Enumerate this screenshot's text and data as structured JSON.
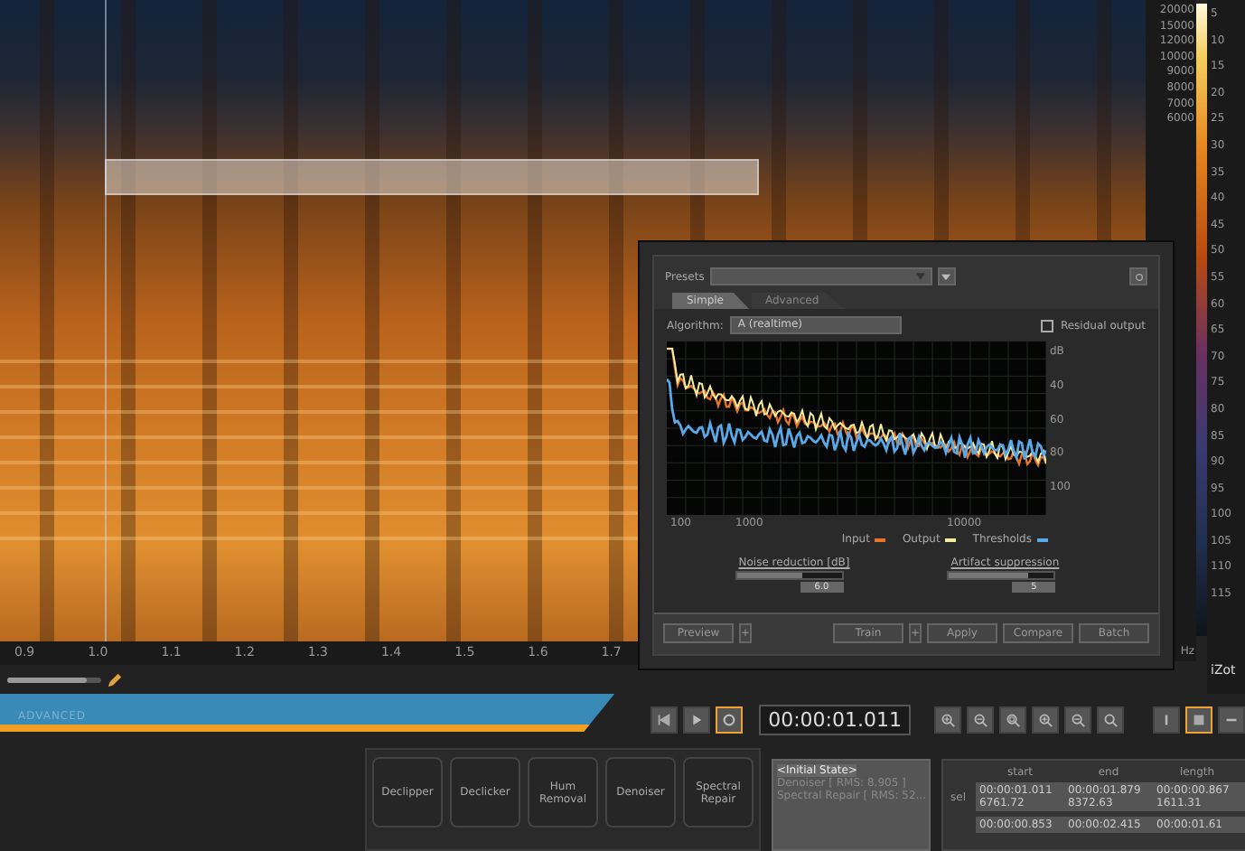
{
  "spectrogram": {
    "time_ticks": [
      "0.9",
      "1.0",
      "1.1",
      "1.2",
      "1.3",
      "1.4",
      "1.5",
      "1.6",
      "1.7"
    ],
    "freq_labels": [
      "20000",
      "15000",
      "12000",
      "10000",
      "9000",
      "8000",
      "7000",
      "6000"
    ],
    "unit": "Hz",
    "db_labels": [
      "5",
      "10",
      "15",
      "20",
      "25",
      "30",
      "35",
      "40",
      "45",
      "50",
      "55",
      "60",
      "65",
      "70",
      "75",
      "80",
      "85",
      "90",
      "95",
      "100",
      "105",
      "110",
      "115"
    ],
    "logo": "iZot",
    "zoom_slider": {
      "level": 0.85
    }
  },
  "dialog": {
    "presets_label": "Presets",
    "tabs": [
      {
        "label": "Simple",
        "selected": true
      },
      {
        "label": "Advanced",
        "selected": false
      }
    ],
    "algorithm_label": "Algorithm:",
    "algorithm_value": "A (realtime)",
    "residual": {
      "label": "Residual output",
      "checked": false
    },
    "plot": {
      "x_ticks": [
        "100",
        "1000",
        "10000"
      ],
      "y_labels": [
        "dB",
        "40",
        "60",
        "80",
        "100"
      ]
    },
    "legend": [
      {
        "label": "Input",
        "color": "#e8742a"
      },
      {
        "label": "Output",
        "color": "#f2eda0"
      },
      {
        "label": "Thresholds",
        "color": "#5aa8e8"
      }
    ],
    "sliders": [
      {
        "label": "Noise reduction [dB]",
        "value": "6.0",
        "level": 0.62
      },
      {
        "label": "Artifact suppression",
        "value": "5",
        "level": 0.75
      }
    ],
    "buttons": [
      {
        "label": "Preview",
        "kind": "wide"
      },
      {
        "label": "+",
        "kind": "small"
      },
      {
        "label": "Train",
        "kind": "wide"
      },
      {
        "label": "+",
        "kind": "small"
      },
      {
        "label": "Apply",
        "kind": "wide"
      },
      {
        "label": "Compare",
        "kind": "wide"
      },
      {
        "label": "Batch",
        "kind": "wide"
      }
    ]
  },
  "mode_label": "ADVANCED",
  "transport": [
    {
      "kind": "skip-start",
      "selected": false
    },
    {
      "kind": "play",
      "selected": false
    },
    {
      "kind": "loop",
      "selected": true
    }
  ],
  "time_display": "00:00:01.011",
  "zoom_tools": [
    {
      "kind": "zoom-in"
    },
    {
      "kind": "zoom-out"
    },
    {
      "kind": "zoom-fit"
    },
    {
      "kind": "zoom-in"
    },
    {
      "kind": "zoom-out"
    },
    {
      "kind": "zoom-reset"
    }
  ],
  "view_tools": [
    {
      "kind": "info",
      "selected": false
    },
    {
      "kind": "grid",
      "selected": true
    },
    {
      "kind": "minus",
      "selected": false
    }
  ],
  "modules": [
    "Declipper",
    "Declicker",
    "Hum\nRemoval",
    "Denoiser",
    "Spectral\nRepair"
  ],
  "history": [
    {
      "label": "<Initial State>",
      "selected": true
    },
    {
      "label": "Denoiser [ RMS: 8.905 ]",
      "selected": false
    },
    {
      "label": "Spectral Repair [ RMS: 52...",
      "selected": false
    }
  ],
  "selection_table": {
    "columns": [
      "start",
      "end",
      "length"
    ],
    "row_label": "sel",
    "rows": [
      [
        "00:00:01.011",
        "00:00:01.879",
        "00:00:00.867"
      ],
      [
        "6761.72",
        "8372.63",
        "1611.31"
      ]
    ],
    "view_row": [
      "00:00:00.853",
      "00:00:02.415",
      "00:00:01.61"
    ]
  }
}
